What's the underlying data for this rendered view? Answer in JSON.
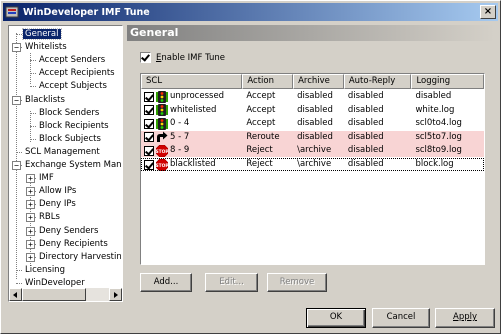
{
  "window": {
    "title": "WinDeveloper IMF Tune",
    "close_label": "×"
  },
  "tree": {
    "items": [
      {
        "label": "General",
        "selected": true
      },
      {
        "label": "Whitelists"
      },
      {
        "label": "Accept Senders"
      },
      {
        "label": "Accept Recipients"
      },
      {
        "label": "Accept Subjects"
      },
      {
        "label": "Blacklists"
      },
      {
        "label": "Block Senders"
      },
      {
        "label": "Block Recipients"
      },
      {
        "label": "Block Subjects"
      },
      {
        "label": "SCL Management"
      },
      {
        "label": "Exchange System Manag"
      },
      {
        "label": "IMF"
      },
      {
        "label": "Allow IPs"
      },
      {
        "label": "Deny IPs"
      },
      {
        "label": "RBLs"
      },
      {
        "label": "Deny Senders"
      },
      {
        "label": "Deny Recipients"
      },
      {
        "label": "Directory Harvesting"
      },
      {
        "label": "Licensing"
      },
      {
        "label": "WinDeveloper"
      }
    ],
    "expander_minus": "−",
    "expander_plus": "+"
  },
  "panel": {
    "header": "General",
    "enable_label_u": "E",
    "enable_label_rest": "nable IMF Tune",
    "enable_checked": true
  },
  "list": {
    "columns": [
      "SCL",
      "Action",
      "Archive",
      "Auto-Reply",
      "Logging"
    ],
    "rows": [
      {
        "scl": "unprocessed",
        "action": "Accept",
        "archive": "disabled",
        "autoreply": "disabled",
        "logging": "disabled",
        "icon": "traffic-light-icon",
        "highlight": false
      },
      {
        "scl": "whitelisted",
        "action": "Accept",
        "archive": "disabled",
        "autoreply": "disabled",
        "logging": "white.log",
        "icon": "traffic-light-icon",
        "highlight": false
      },
      {
        "scl": "0 - 4",
        "action": "Accept",
        "archive": "disabled",
        "autoreply": "disabled",
        "logging": "scl0to4.log",
        "icon": "traffic-light-icon",
        "highlight": false
      },
      {
        "scl": "5 - 7",
        "action": "Reroute",
        "archive": "disabled",
        "autoreply": "disabled",
        "logging": "scl5to7.log",
        "icon": "reroute-arrow-icon",
        "highlight": true
      },
      {
        "scl": "8 - 9",
        "action": "Reject",
        "archive": "\\archive",
        "autoreply": "disabled",
        "logging": "scl8to9.log",
        "icon": "stop-sign-icon",
        "highlight": true
      },
      {
        "scl": "blacklisted",
        "action": "Reject",
        "archive": "\\archive",
        "autoreply": "disabled",
        "logging": "block.log",
        "icon": "stop-sign-icon",
        "highlight": false,
        "focused": true
      }
    ]
  },
  "buttons": {
    "add": "Add...",
    "edit": "Edit...",
    "remove": "Remove",
    "ok": "OK",
    "cancel": "Cancel",
    "apply": "Apply"
  }
}
